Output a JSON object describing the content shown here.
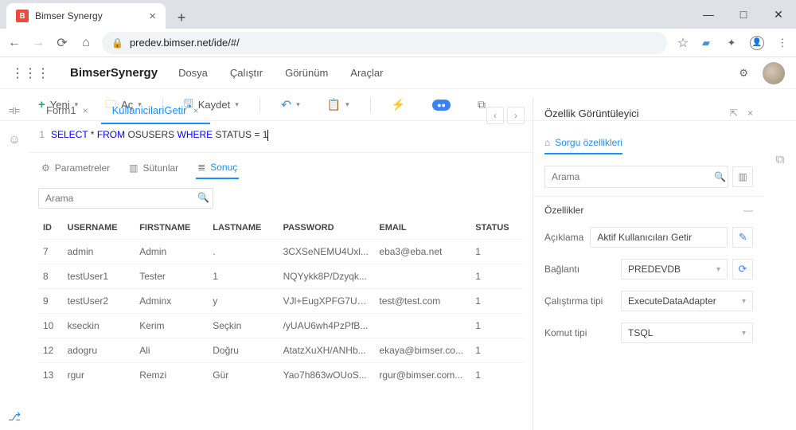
{
  "browser": {
    "tab_title": "Bimser Synergy",
    "url": "predev.bimser.net/ide/#/"
  },
  "app": {
    "brand": "BimserSynergy",
    "menu": [
      "Dosya",
      "Çalıştır",
      "Görünüm",
      "Araçlar"
    ]
  },
  "toolbar": {
    "new": "Yeni",
    "open": "Aç",
    "save": "Kaydet"
  },
  "tabs": {
    "t1": "Form1",
    "t2": "KullanicilariGetir"
  },
  "editor": {
    "line_no": "1",
    "code_parts": {
      "p1": "SELECT",
      "p2": " * ",
      "p3": "FROM",
      "p4": " OSUSERS ",
      "p5": "WHERE",
      "p6": " STATUS = 1"
    }
  },
  "result_tabs": {
    "params": "Parametreler",
    "cols": "Sütunlar",
    "result": "Sonuç"
  },
  "search_placeholder": "Arama",
  "table": {
    "headers": {
      "id": "ID",
      "user": "USERNAME",
      "first": "FIRSTNAME",
      "last": "LASTNAME",
      "pass": "PASSWORD",
      "email": "EMAIL",
      "status": "STATUS"
    },
    "rows": [
      {
        "id": "7",
        "user": "admin",
        "first": "Admin",
        "last": ".",
        "pass": "3CXSeNEMU4Uxl...",
        "email": "eba3@eba.net",
        "status": "1"
      },
      {
        "id": "8",
        "user": "testUser1",
        "first": "Tester",
        "last": "1",
        "pass": "NQYykk8P/Dzyqk...",
        "email": "",
        "status": "1"
      },
      {
        "id": "9",
        "user": "testUser2",
        "first": "Adminx",
        "last": "y",
        "pass": "VJl+EugXPFG7UB...",
        "email": "test@test.com",
        "status": "1"
      },
      {
        "id": "10",
        "user": "kseckin",
        "first": "Kerim",
        "last": "Seçkin",
        "pass": "/yUAU6wh4PzPfB...",
        "email": "",
        "status": "1"
      },
      {
        "id": "12",
        "user": "adogru",
        "first": "Ali",
        "last": "Doğru",
        "pass": "AtatzXuXH/ANHb...",
        "email": "ekaya@bimser.co...",
        "status": "1"
      },
      {
        "id": "13",
        "user": "rgur",
        "first": "Remzi",
        "last": "Gür",
        "pass": "Yao7h863wOUoS...",
        "email": "rgur@bimser.com...",
        "status": "1"
      }
    ]
  },
  "right": {
    "title": "Özellik Görüntüleyici",
    "subtab": "Sorgu özellikleri",
    "search_placeholder": "Arama",
    "section": "Özellikler",
    "fields": {
      "desc_label": "Açıklama",
      "desc_value": "Aktif Kullanıcıları Getir",
      "conn_label": "Bağlantı",
      "conn_value": "PREDEVDB",
      "exec_label": "Çalıştırma tipi",
      "exec_value": "ExecuteDataAdapter",
      "cmd_label": "Komut tipi",
      "cmd_value": "TSQL"
    }
  }
}
